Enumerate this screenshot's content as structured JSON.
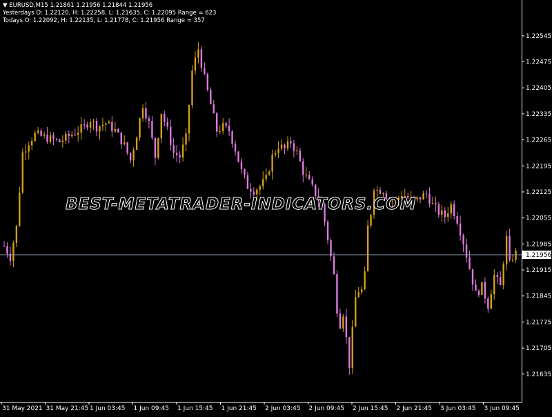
{
  "header": {
    "symbol_line_marker": "▼",
    "symbol_line": "EURUSD,M15  1.21861 1.21956 1.21844 1.21956",
    "yesterday_line": "Yesterdays O: 1.22120, H: 1.22258, L: 1.21635, C: 1.22095 Range = 623",
    "today_line": "Todays O: 1.22092, H: 1.22135, L: 1.21778, C: 1.21956 Range = 357"
  },
  "watermark": "BEST-METATRADER-INDICATORS.COM",
  "colors": {
    "background": "#000000",
    "bull": "#d4a017",
    "bear": "#e07ae0",
    "price_line": "#8f9fb0",
    "price_label_bg": "#ffffff",
    "axis_text": "#ffffff"
  },
  "chart_data": {
    "type": "candlestick",
    "symbol": "EURUSD",
    "timeframe": "M15",
    "ylim": [
      1.2159,
      1.2258
    ],
    "current_price": 1.21956,
    "current_price_label": "1.21956",
    "y_ticks": [
      "1.22545",
      "1.22475",
      "1.22405",
      "1.22335",
      "1.22265",
      "1.22195",
      "1.22125",
      "1.22055",
      "1.21985",
      "1.21915",
      "1.21845",
      "1.21775",
      "1.21705",
      "1.21635"
    ],
    "x_ticks": [
      "31 May 2021",
      "31 May 21:45",
      "1 Jun 03:45",
      "1 Jun 09:45",
      "1 Jun 15:45",
      "1 Jun 21:45",
      "2 Jun 03:45",
      "2 Jun 09:45",
      "2 Jun 15:45",
      "2 Jun 21:45",
      "3 Jun 03:45",
      "3 Jun 09:45"
    ],
    "close_path": [
      [
        0,
        1.2198
      ],
      [
        2,
        1.2195
      ],
      [
        4,
        1.2203
      ],
      [
        6,
        1.2223
      ],
      [
        8,
        1.2226
      ],
      [
        10,
        1.2228
      ],
      [
        14,
        1.2227
      ],
      [
        18,
        1.2226
      ],
      [
        22,
        1.2228
      ],
      [
        26,
        1.223
      ],
      [
        28,
        1.2232
      ],
      [
        30,
        1.223
      ],
      [
        33,
        1.2231
      ],
      [
        36,
        1.2229
      ],
      [
        39,
        1.2225
      ],
      [
        41,
        1.2221
      ],
      [
        43,
        1.2228
      ],
      [
        45,
        1.2236
      ],
      [
        47,
        1.2231
      ],
      [
        49,
        1.2222
      ],
      [
        51,
        1.2234
      ],
      [
        53,
        1.2229
      ],
      [
        55,
        1.2223
      ],
      [
        57,
        1.2222
      ],
      [
        59,
        1.2227
      ],
      [
        61,
        1.2245
      ],
      [
        63,
        1.2251
      ],
      [
        65,
        1.2243
      ],
      [
        67,
        1.2236
      ],
      [
        69,
        1.2229
      ],
      [
        71,
        1.223
      ],
      [
        73,
        1.2229
      ],
      [
        75,
        1.2224
      ],
      [
        77,
        1.2218
      ],
      [
        79,
        1.2214
      ],
      [
        81,
        1.2213
      ],
      [
        83,
        1.2214
      ],
      [
        85,
        1.2216
      ],
      [
        87,
        1.2222
      ],
      [
        89,
        1.2225
      ],
      [
        91,
        1.2224
      ],
      [
        93,
        1.2226
      ],
      [
        95,
        1.2223
      ],
      [
        97,
        1.2218
      ],
      [
        99,
        1.2215
      ],
      [
        101,
        1.2212
      ],
      [
        103,
        1.2209
      ],
      [
        105,
        1.22
      ],
      [
        107,
        1.219
      ],
      [
        108,
        1.2181
      ],
      [
        109,
        1.2177
      ],
      [
        110,
        1.218
      ],
      [
        111,
        1.2173
      ],
      [
        112,
        1.2166
      ],
      [
        113,
        1.2175
      ],
      [
        114,
        1.2184
      ],
      [
        115,
        1.2186
      ],
      [
        116,
        1.2186
      ],
      [
        117,
        1.219
      ],
      [
        118,
        1.2203
      ],
      [
        119,
        1.2207
      ],
      [
        120,
        1.2214
      ],
      [
        121,
        1.2213
      ],
      [
        123,
        1.2213
      ],
      [
        125,
        1.221
      ],
      [
        127,
        1.221
      ],
      [
        129,
        1.2212
      ],
      [
        131,
        1.2211
      ],
      [
        133,
        1.221
      ],
      [
        135,
        1.2211
      ],
      [
        137,
        1.2212
      ],
      [
        139,
        1.2209
      ],
      [
        141,
        1.2207
      ],
      [
        143,
        1.2206
      ],
      [
        145,
        1.2209
      ],
      [
        147,
        1.2205
      ],
      [
        149,
        1.2199
      ],
      [
        151,
        1.2192
      ],
      [
        153,
        1.2185
      ],
      [
        155,
        1.2187
      ],
      [
        157,
        1.2182
      ],
      [
        159,
        1.219
      ],
      [
        161,
        1.2187
      ],
      [
        162,
        1.2194
      ],
      [
        163,
        1.22
      ],
      [
        164,
        1.2193
      ],
      [
        165,
        1.2195
      ],
      [
        166,
        1.2196
      ]
    ]
  }
}
